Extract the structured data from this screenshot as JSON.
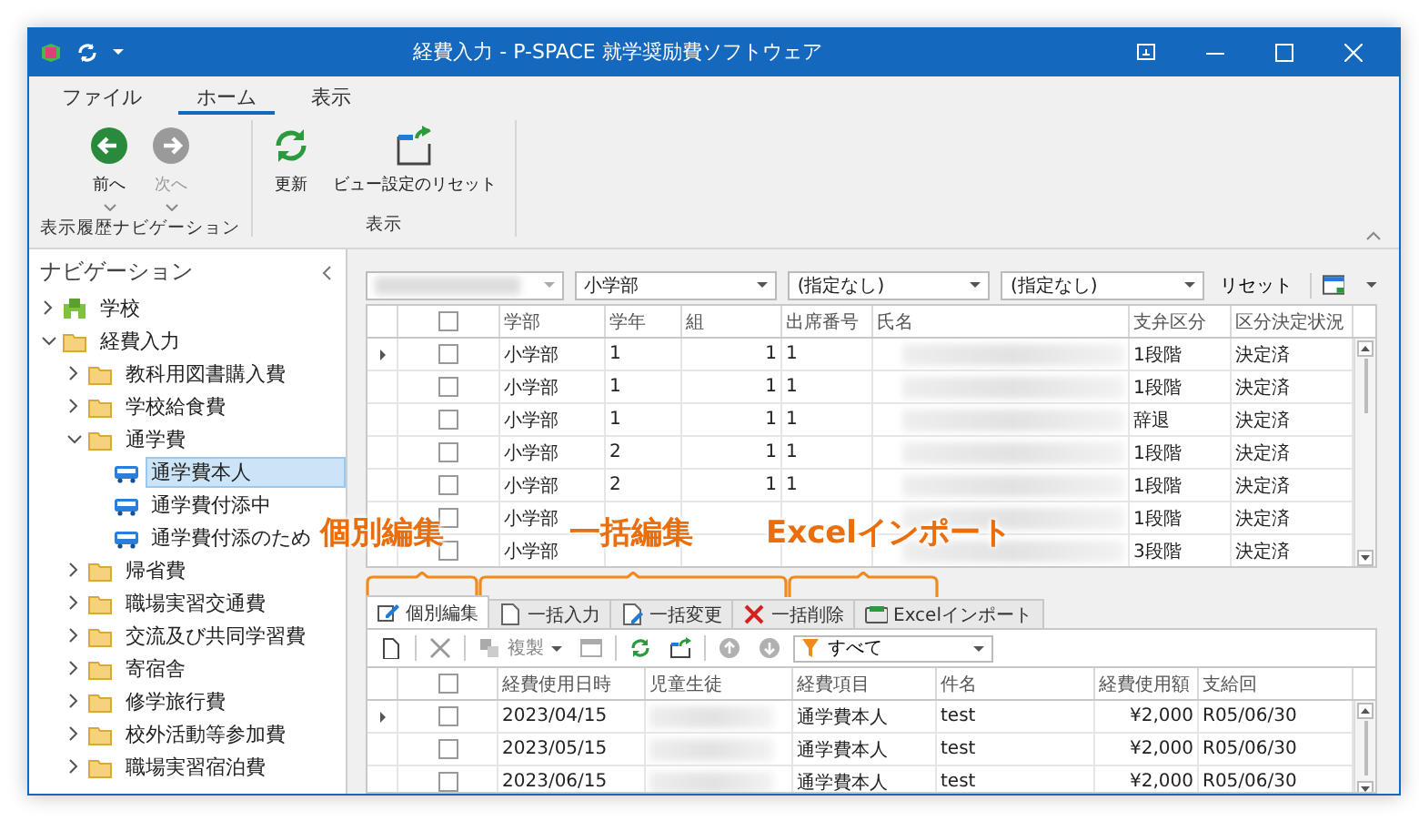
{
  "window": {
    "title": "経費入力 - P-SPACE 就学奨励費ソフトウェア"
  },
  "ribbon": {
    "tabs": [
      {
        "label": "ファイル",
        "selected": false
      },
      {
        "label": "ホーム",
        "selected": true
      },
      {
        "label": "表示",
        "selected": false
      }
    ],
    "groups": [
      {
        "label": "表示履歴ナビゲーション",
        "buttons": [
          {
            "label": "前へ",
            "kind": "back",
            "disabled": false,
            "dropdown": true
          },
          {
            "label": "次へ",
            "kind": "forward",
            "disabled": true,
            "dropdown": true
          }
        ]
      },
      {
        "label": "表示",
        "buttons": [
          {
            "label": "更新",
            "kind": "refresh",
            "disabled": false,
            "dropdown": false
          },
          {
            "label": "ビュー設定のリセット",
            "kind": "reset-view",
            "disabled": false,
            "dropdown": false
          }
        ]
      }
    ]
  },
  "navigation": {
    "title": "ナビゲーション",
    "items": [
      {
        "label": "学校",
        "kind": "school",
        "expanded": false,
        "selected": false
      },
      {
        "label": "経費入力",
        "kind": "folder",
        "expanded": true,
        "selected": false,
        "children": [
          {
            "label": "教科用図書購入費",
            "kind": "folder",
            "expanded": false,
            "selected": false
          },
          {
            "label": "学校給食費",
            "kind": "folder",
            "expanded": false,
            "selected": false
          },
          {
            "label": "通学費",
            "kind": "folder",
            "expanded": true,
            "selected": false,
            "children": [
              {
                "label": "通学費本人",
                "kind": "bus",
                "selected": true
              },
              {
                "label": "通学費付添中",
                "kind": "bus",
                "selected": false
              },
              {
                "label": "通学費付添のため",
                "kind": "bus",
                "selected": false
              }
            ]
          },
          {
            "label": "帰省費",
            "kind": "folder",
            "expanded": false,
            "selected": false
          },
          {
            "label": "職場実習交通費",
            "kind": "folder",
            "expanded": false,
            "selected": false
          },
          {
            "label": "交流及び共同学習費",
            "kind": "folder",
            "expanded": false,
            "selected": false
          },
          {
            "label": "寄宿舎",
            "kind": "folder",
            "expanded": false,
            "selected": false
          },
          {
            "label": "修学旅行費",
            "kind": "folder",
            "expanded": false,
            "selected": false
          },
          {
            "label": "校外活動等参加費",
            "kind": "folder",
            "expanded": false,
            "selected": false
          },
          {
            "label": "職場実習宿泊費",
            "kind": "folder",
            "expanded": false,
            "selected": false
          }
        ]
      }
    ]
  },
  "filters": {
    "combos": [
      {
        "kind": "blurred"
      },
      {
        "kind": "combo",
        "value": "小学部"
      },
      {
        "kind": "combo",
        "value": "(指定なし)"
      },
      {
        "kind": "combo",
        "value": "(指定なし)"
      }
    ],
    "reset": "リセット"
  },
  "students_grid": {
    "header_checked": false,
    "columns": [
      {
        "label": "学部",
        "kind": "text"
      },
      {
        "label": "学年",
        "kind": "text"
      },
      {
        "label": "組",
        "kind": "text"
      },
      {
        "label": "出席番号",
        "kind": "text"
      },
      {
        "label": "氏名",
        "kind": "blurred"
      },
      {
        "label": "支弁区分",
        "kind": "text"
      },
      {
        "label": "区分決定状況",
        "kind": "text"
      }
    ],
    "rows": [
      {
        "current": true,
        "checked": false,
        "cells": [
          "小学部",
          "1",
          "1",
          "1",
          null,
          "1段階",
          "決定済"
        ]
      },
      {
        "current": false,
        "checked": false,
        "cells": [
          "小学部",
          "1",
          "1",
          "1",
          null,
          "1段階",
          "決定済"
        ]
      },
      {
        "current": false,
        "checked": false,
        "cells": [
          "小学部",
          "1",
          "1",
          "1",
          null,
          "辞退",
          "決定済"
        ]
      },
      {
        "current": false,
        "checked": false,
        "cells": [
          "小学部",
          "2",
          "1",
          "1",
          null,
          "1段階",
          "決定済"
        ]
      },
      {
        "current": false,
        "checked": false,
        "cells": [
          "小学部",
          "2",
          "1",
          "1",
          null,
          "1段階",
          "決定済"
        ]
      },
      {
        "current": false,
        "checked": false,
        "cells": [
          "小学部",
          null,
          null,
          null,
          null,
          "1段階",
          "決定済"
        ]
      },
      {
        "current": false,
        "checked": false,
        "cells": [
          "小学部",
          null,
          null,
          null,
          null,
          "3段階",
          "決定済"
        ]
      }
    ]
  },
  "annotations": [
    {
      "label": "個別編集"
    },
    {
      "label": "一括編集"
    },
    {
      "label": "Excelインポート"
    }
  ],
  "edit_tabs": [
    {
      "label": "個別編集",
      "kind": "edit",
      "selected": true
    },
    {
      "label": "一括入力",
      "kind": "input",
      "selected": false
    },
    {
      "label": "一括変更",
      "kind": "change",
      "selected": false
    },
    {
      "label": "一括削除",
      "kind": "delete",
      "selected": false
    },
    {
      "label": "Excelインポート",
      "kind": "excel",
      "selected": false
    }
  ],
  "toolbar": {
    "buttons": [
      {
        "kind": "new",
        "disabled": false
      },
      {
        "kind": "delete",
        "disabled": true
      },
      {
        "kind": "copy",
        "label": "複製",
        "disabled": true
      },
      {
        "kind": "layout",
        "disabled": true
      },
      {
        "kind": "refresh",
        "disabled": false
      },
      {
        "kind": "export",
        "disabled": false
      },
      {
        "kind": "up",
        "disabled": true
      },
      {
        "kind": "down",
        "disabled": true
      }
    ],
    "filter": "すべて"
  },
  "expenses_grid": {
    "header_checked": false,
    "columns": [
      {
        "label": "経費使用日時",
        "kind": "text"
      },
      {
        "label": "児童生徒",
        "kind": "blurred"
      },
      {
        "label": "経費項目",
        "kind": "text"
      },
      {
        "label": "件名",
        "kind": "text"
      },
      {
        "label": "経費使用額",
        "kind": "text"
      },
      {
        "label": "支給回",
        "kind": "text"
      }
    ],
    "rows": [
      {
        "current": true,
        "checked": false,
        "cells": [
          "2023/04/15",
          null,
          "通学費本人",
          "test",
          "¥2,000",
          "R05/06/30"
        ]
      },
      {
        "current": false,
        "checked": false,
        "cells": [
          "2023/05/15",
          null,
          "通学費本人",
          "test",
          "¥2,000",
          "R05/06/30"
        ]
      },
      {
        "current": false,
        "checked": false,
        "cells": [
          "2023/06/15",
          null,
          "通学費本人",
          "test",
          "¥2,000",
          "R05/06/30"
        ]
      }
    ]
  }
}
